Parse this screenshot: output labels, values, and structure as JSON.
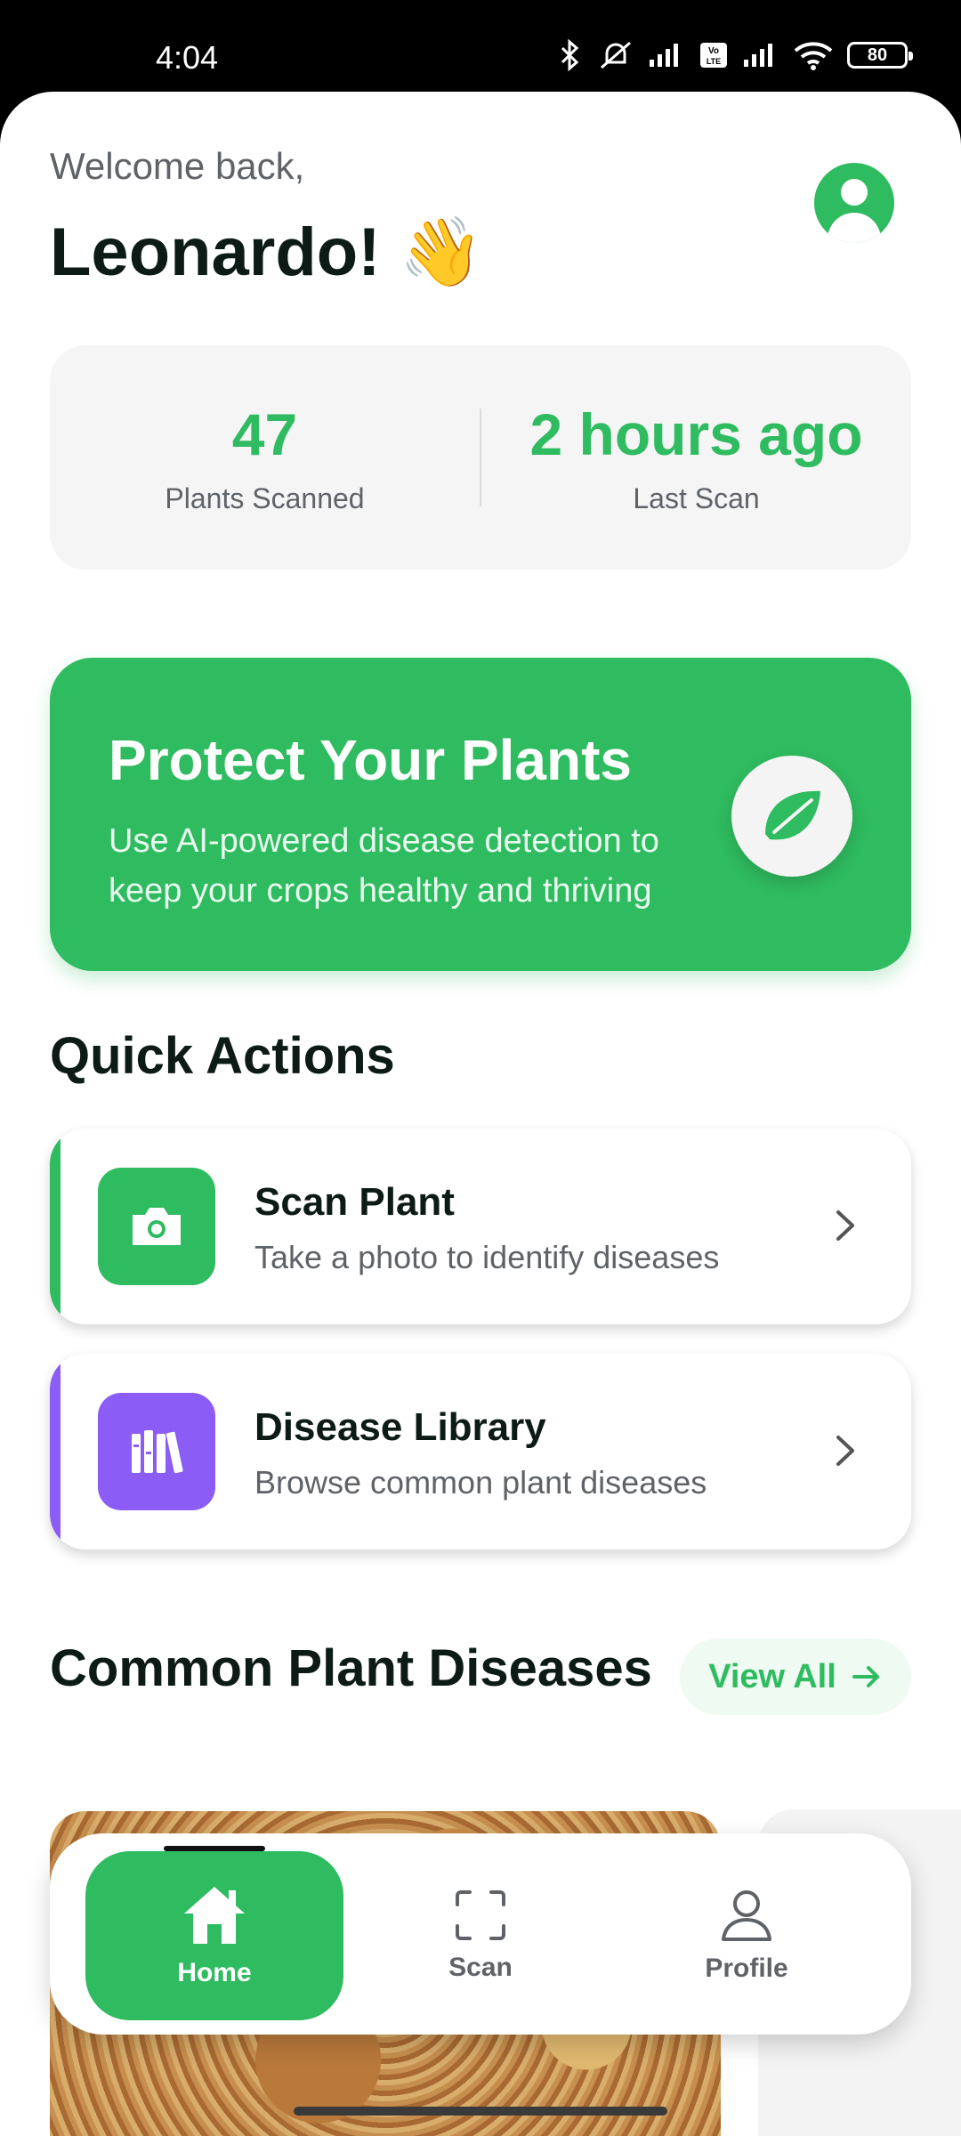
{
  "status_bar": {
    "time": "4:04",
    "battery": "80"
  },
  "header": {
    "greeting": "Welcome back,",
    "user_name": "Leonardo! 👋"
  },
  "stats": {
    "plants_scanned_value": "47",
    "plants_scanned_label": "Plants Scanned",
    "last_scan_value": "2 hours ago",
    "last_scan_label": "Last Scan"
  },
  "hero": {
    "title": "Protect Your Plants",
    "subtitle": "Use AI-powered disease detection to keep your crops healthy and thriving"
  },
  "quick_actions": {
    "title": "Quick Actions",
    "items": [
      {
        "title": "Scan Plant",
        "subtitle": "Take a photo to identify diseases",
        "icon": "camera-icon",
        "color": "#2fbb5f"
      },
      {
        "title": "Disease Library",
        "subtitle": "Browse common plant diseases",
        "icon": "library-icon",
        "color": "#8b5cf6"
      }
    ]
  },
  "diseases": {
    "title": "Common Plant Diseases",
    "view_all": "View All"
  },
  "bottom_nav": {
    "items": [
      {
        "label": "Home",
        "icon": "home-icon",
        "active": true
      },
      {
        "label": "Scan",
        "icon": "scan-icon",
        "active": false
      },
      {
        "label": "Profile",
        "icon": "profile-icon",
        "active": false
      }
    ]
  },
  "colors": {
    "primary": "#2fbb5f",
    "secondary": "#8b5cf6",
    "text_dark": "#0d1b17",
    "text_muted": "#5f6368"
  }
}
